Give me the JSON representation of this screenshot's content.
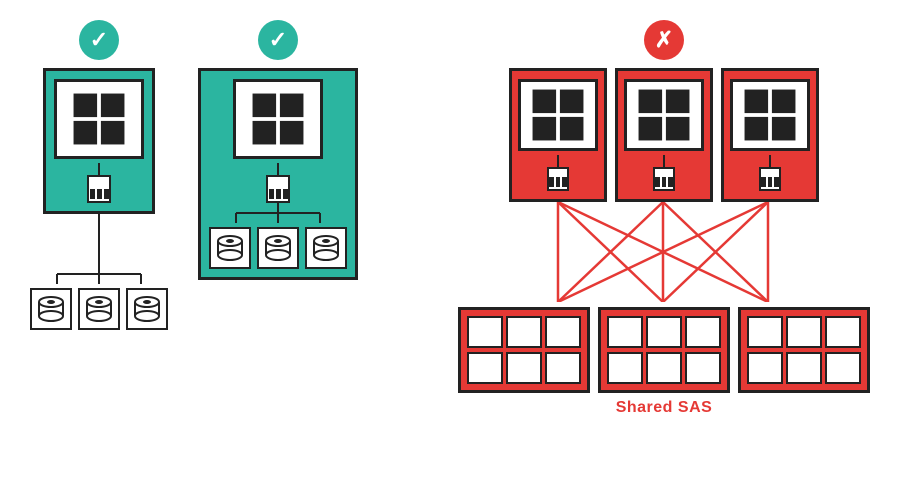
{
  "scenarios": [
    {
      "id": "s1",
      "badge_type": "green",
      "badge_icon": "✓",
      "servers": 1,
      "disks_inside": false,
      "disk_groups": 3
    },
    {
      "id": "s2",
      "badge_type": "green",
      "badge_icon": "✓",
      "servers": 1,
      "disks_inside": true,
      "disk_groups": 3
    },
    {
      "id": "s3",
      "badge_type": "red",
      "badge_icon": "✗",
      "servers": 3,
      "disks_inside": false,
      "disk_groups": 3,
      "label": "Shared SAS"
    }
  ]
}
